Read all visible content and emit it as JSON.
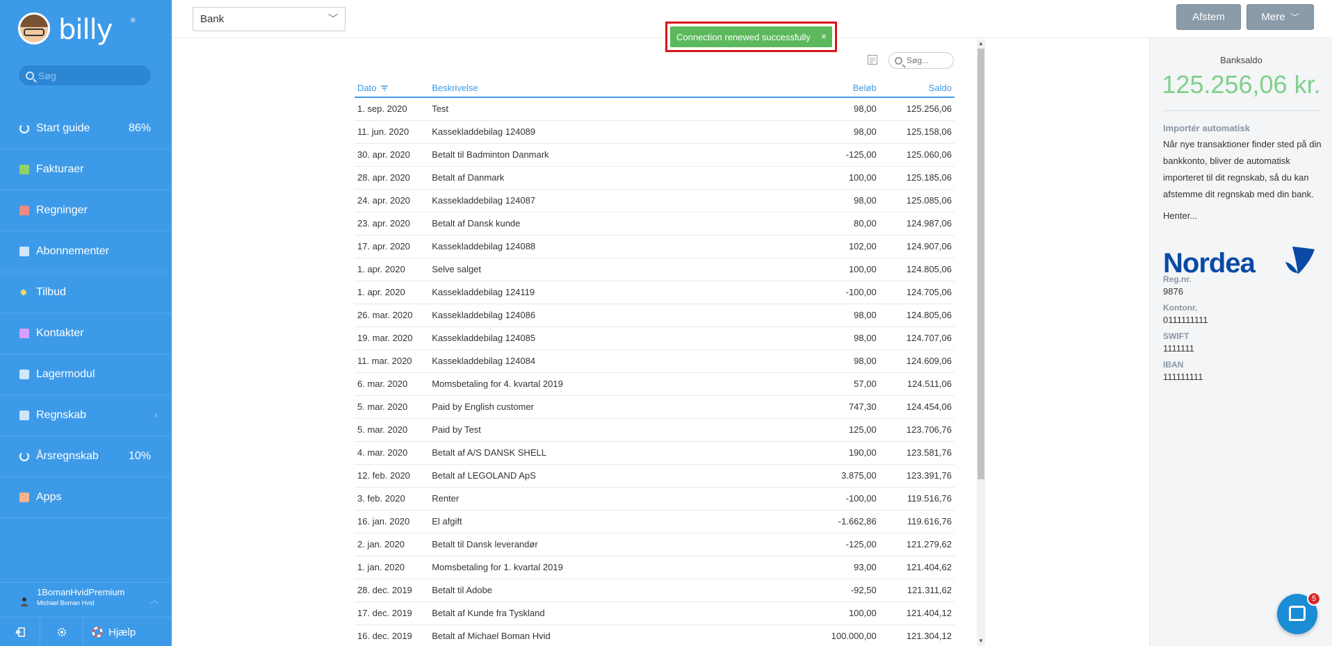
{
  "app": {
    "logo_text": "billy",
    "logo_reg": "®"
  },
  "sidebar": {
    "search_placeholder": "Søg",
    "items": [
      {
        "label": "Start guide",
        "pct": "86%",
        "icon": "progress-ring-icon",
        "color": "#ffffff"
      },
      {
        "label": "Fakturaer",
        "icon": "invoice-icon",
        "color": "#8fd36a"
      },
      {
        "label": "Regninger",
        "icon": "bill-icon",
        "color": "#f08a7e"
      },
      {
        "label": "Abonnementer",
        "icon": "subscription-icon",
        "color": "#cfe6fb"
      },
      {
        "label": "Tilbud",
        "icon": "star-icon",
        "color": "#ffd95a"
      },
      {
        "label": "Kontakter",
        "icon": "contact-icon",
        "color": "#d7a0ff"
      },
      {
        "label": "Lagermodul",
        "icon": "inventory-icon",
        "color": "#cfe6fb"
      },
      {
        "label": "Regnskab",
        "icon": "accounting-icon",
        "color": "#cfe6fb",
        "has_submenu": true
      },
      {
        "label": "Årsregnskab",
        "pct": "10%",
        "icon": "progress-ring-icon",
        "color": "#ffffff"
      },
      {
        "label": "Apps",
        "icon": "apps-icon",
        "color": "#f7b38a"
      }
    ],
    "user": {
      "org": "1BomanHvidPremium",
      "name": "Michael Boman Hvid"
    },
    "bottom": {
      "help_label": "Hjælp"
    }
  },
  "topbar": {
    "account_select": "Bank",
    "btn_afstem": "Afstem",
    "btn_mere": "Mere"
  },
  "toast": {
    "message": "Connection renewed successfully",
    "close": "×"
  },
  "table": {
    "search_placeholder": "Søg...",
    "headers": {
      "date": "Dato",
      "desc": "Beskrivelse",
      "amount": "Beløb",
      "balance": "Saldo"
    },
    "rows": [
      {
        "date": "1. sep. 2020",
        "desc": "Test",
        "amount": "98,00",
        "balance": "125.256,06",
        "sign": "pos"
      },
      {
        "date": "11. jun. 2020",
        "desc": "Kassekladdebilag 124089",
        "amount": "98,00",
        "balance": "125.158,06",
        "sign": "pos"
      },
      {
        "date": "30. apr. 2020",
        "desc": "Betalt til Badminton Danmark",
        "amount": "-125,00",
        "balance": "125.060,06",
        "sign": "neg"
      },
      {
        "date": "28. apr. 2020",
        "desc": "Betalt af Danmark",
        "amount": "100,00",
        "balance": "125.185,06",
        "sign": "pos"
      },
      {
        "date": "24. apr. 2020",
        "desc": "Kassekladdebilag 124087",
        "amount": "98,00",
        "balance": "125.085,06",
        "sign": "pos"
      },
      {
        "date": "23. apr. 2020",
        "desc": "Betalt af Dansk kunde",
        "amount": "80,00",
        "balance": "124.987,06",
        "sign": "pos"
      },
      {
        "date": "17. apr. 2020",
        "desc": "Kassekladdebilag 124088",
        "amount": "102,00",
        "balance": "124.907,06",
        "sign": "pos"
      },
      {
        "date": "1. apr. 2020",
        "desc": "Selve salget",
        "amount": "100,00",
        "balance": "124.805,06",
        "sign": "pos"
      },
      {
        "date": "1. apr. 2020",
        "desc": "Kassekladdebilag 124119",
        "amount": "-100,00",
        "balance": "124.705,06",
        "sign": "neg"
      },
      {
        "date": "26. mar. 2020",
        "desc": "Kassekladdebilag 124086",
        "amount": "98,00",
        "balance": "124.805,06",
        "sign": "pos"
      },
      {
        "date": "19. mar. 2020",
        "desc": "Kassekladdebilag 124085",
        "amount": "98,00",
        "balance": "124.707,06",
        "sign": "pos"
      },
      {
        "date": "11. mar. 2020",
        "desc": "Kassekladdebilag 124084",
        "amount": "98,00",
        "balance": "124.609,06",
        "sign": "pos"
      },
      {
        "date": "6. mar. 2020",
        "desc": "Momsbetaling for 4. kvartal 2019",
        "amount": "57,00",
        "balance": "124.511,06",
        "sign": "pos"
      },
      {
        "date": "5. mar. 2020",
        "desc": "Paid by English customer",
        "amount": "747,30",
        "balance": "124.454,06",
        "sign": "pos"
      },
      {
        "date": "5. mar. 2020",
        "desc": "Paid by Test",
        "amount": "125,00",
        "balance": "123.706,76",
        "sign": "pos"
      },
      {
        "date": "4. mar. 2020",
        "desc": "Betalt af A/S DANSK SHELL",
        "amount": "190,00",
        "balance": "123.581,76",
        "sign": "pos"
      },
      {
        "date": "12. feb. 2020",
        "desc": "Betalt af LEGOLAND ApS",
        "amount": "3.875,00",
        "balance": "123.391,76",
        "sign": "pos"
      },
      {
        "date": "3. feb. 2020",
        "desc": "Renter",
        "amount": "-100,00",
        "balance": "119.516,76",
        "sign": "neg"
      },
      {
        "date": "16. jan. 2020",
        "desc": "El afgift",
        "amount": "-1.662,86",
        "balance": "119.616,76",
        "sign": "neg"
      },
      {
        "date": "2. jan. 2020",
        "desc": "Betalt til Dansk leverandør",
        "amount": "-125,00",
        "balance": "121.279,62",
        "sign": "neg"
      },
      {
        "date": "1. jan. 2020",
        "desc": "Momsbetaling for 1. kvartal 2019",
        "amount": "93,00",
        "balance": "121.404,62",
        "sign": "pos"
      },
      {
        "date": "28. dec. 2019",
        "desc": "Betalt til Adobe",
        "amount": "-92,50",
        "balance": "121.311,62",
        "sign": "neg"
      },
      {
        "date": "17. dec. 2019",
        "desc": "Betalt af Kunde fra Tyskland",
        "amount": "100,00",
        "balance": "121.404,12",
        "sign": "pos"
      },
      {
        "date": "16. dec. 2019",
        "desc": "Betalt af Michael Boman Hvid",
        "amount": "100.000,00",
        "balance": "121.304,12",
        "sign": "pos"
      }
    ]
  },
  "panel": {
    "title": "Banksaldo",
    "balance": "125.256,06 kr.",
    "import_heading": "Importér automatisk",
    "import_text": "Når nye transaktioner finder sted på din bankkonto, bliver de automatisk importeret til dit regnskab, så du kan afstemme dit regnskab med din bank.",
    "loading": "Henter...",
    "bank_logo": "Nordea",
    "fields": [
      {
        "label": "Reg.nr.",
        "value": "9876"
      },
      {
        "label": "Kontonr.",
        "value": "0111111111"
      },
      {
        "label": "SWIFT",
        "value": "1111111"
      },
      {
        "label": "IBAN",
        "value": "111111111"
      }
    ]
  },
  "chat": {
    "badge": "5"
  },
  "colors": {
    "sidebar": "#3d9ae8",
    "positive": "#6cc070",
    "negative": "#e0584f",
    "toast": "#5cb85c",
    "toast_frame": "#d9141b",
    "balance": "#7fd08a"
  }
}
